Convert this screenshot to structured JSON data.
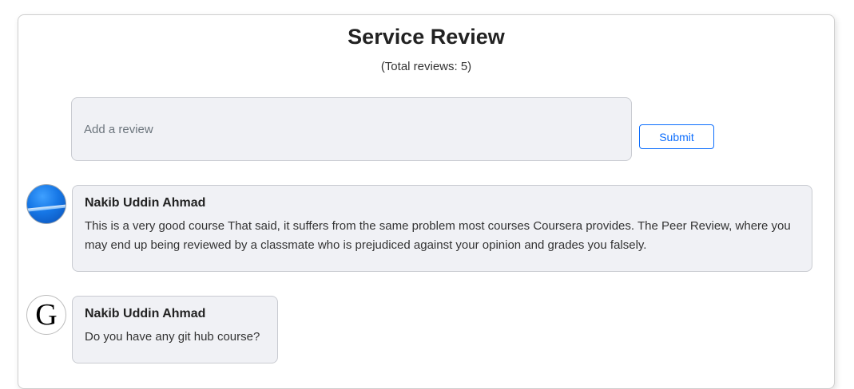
{
  "header": {
    "title": "Service Review",
    "total_reviews": "(Total reviews: 5)"
  },
  "form": {
    "placeholder": "Add a review",
    "submit_label": "Submit"
  },
  "reviews": [
    {
      "author": "Nakib Uddin Ahmad",
      "avatar_icon": "blue-globe-avatar",
      "text": "This is a very good course That said, it suffers from the same problem most courses Coursera provides. The Peer Review, where you may end up being reviewed by a classmate who is prejudiced against your opinion and grades you falsely."
    },
    {
      "author": "Nakib Uddin Ahmad",
      "avatar_letter": "G",
      "avatar_icon": "letter-g-avatar",
      "text": "Do you have any git hub course?"
    }
  ],
  "colors": {
    "accent": "#0d6efd",
    "bubble_bg": "#f0f1f5",
    "border": "#c9cbd1"
  }
}
